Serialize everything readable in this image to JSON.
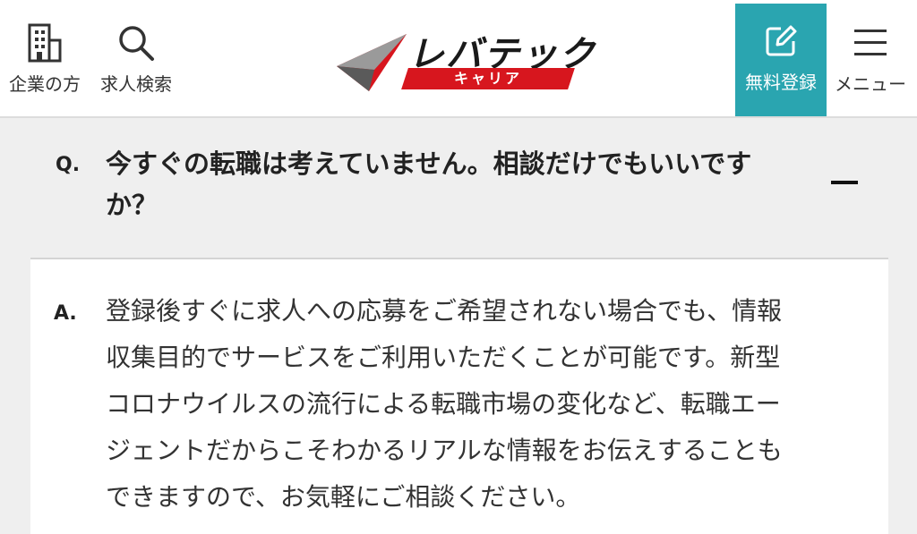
{
  "header": {
    "nav_company_label": "企業の方",
    "nav_search_label": "求人検索",
    "logo": {
      "main_text": "レバテック",
      "sub_text": "キャリア"
    },
    "register_label": "無料登録",
    "menu_label": "メニュー"
  },
  "faq": {
    "question_prefix": "Q.",
    "question_text": "今すぐの転職は考えていません。相談だけでもいいですか？",
    "answer_prefix": "A.",
    "answer_text": "登録後すぐに求人への応募をご希望されない場合でも、情報収集目的でサービスをご利用いただくことが可能です。新型コロナウイルスの流行による転職市場の変化など、転職エージェントだからこそわかるリアルな情報をお伝えすることもできますので、お気軽にご相談ください。"
  },
  "colors": {
    "brand_red": "#d7161e",
    "register_teal": "#2aa5b0",
    "page_bg": "#efefef"
  },
  "icons": {
    "company": "building-icon",
    "search": "search-icon",
    "register": "edit-icon",
    "menu": "hamburger-icon"
  }
}
